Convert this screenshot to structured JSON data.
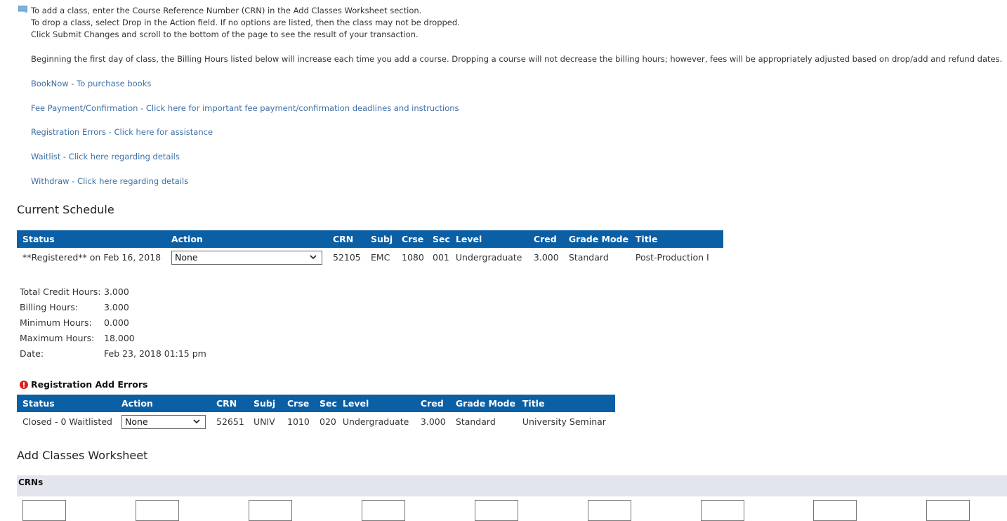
{
  "instructions": {
    "icon": "speech-bubble-icon",
    "lines": [
      "To add a class, enter the Course Reference Number (CRN) in the Add Classes Worksheet section.",
      "To drop a class, select Drop in the Action field. If no options are listed, then the class may not be dropped.",
      "Click Submit Changes and scroll to the bottom of the page to see the result of your transaction."
    ],
    "billing_note": "Beginning the first day of class, the Billing Hours listed below will increase each time you add a course. Dropping a course will not decrease the billing hours; however, fees will be appropriately adjusted based on drop/add and refund dates."
  },
  "links": [
    "BookNow - To purchase books",
    "Fee Payment/Confirmation - Click here for important fee payment/confirmation deadlines and instructions",
    "Registration Errors - Click here for assistance",
    "Waitlist - Click here regarding details",
    "Withdraw - Click here regarding details"
  ],
  "current_schedule": {
    "title": "Current Schedule",
    "columns": [
      "Status",
      "Action",
      "CRN",
      "Subj",
      "Crse",
      "Sec",
      "Level",
      "Cred",
      "Grade Mode",
      "Title"
    ],
    "rows": [
      {
        "status": "**Registered** on Feb 16, 2018",
        "action": "None",
        "crn": "52105",
        "subj": "EMC",
        "crse": "1080",
        "sec": "001",
        "level": "Undergraduate",
        "cred": "3.000",
        "grade_mode": "Standard",
        "title": "Post-Production I"
      }
    ]
  },
  "summary": [
    {
      "label": "Total Credit Hours:",
      "value": "3.000"
    },
    {
      "label": "Billing Hours:",
      "value": "3.000"
    },
    {
      "label": "Minimum Hours:",
      "value": "0.000"
    },
    {
      "label": "Maximum Hours:",
      "value": "18.000"
    },
    {
      "label": "Date:",
      "value": "Feb 23, 2018 01:15 pm"
    }
  ],
  "add_errors": {
    "title": "Registration Add Errors",
    "icon": "error-icon",
    "columns": [
      "Status",
      "Action",
      "CRN",
      "Subj",
      "Crse",
      "Sec",
      "Level",
      "Cred",
      "Grade Mode",
      "Title"
    ],
    "rows": [
      {
        "status": "Closed - 0 Waitlisted",
        "action": "None",
        "crn": "52651",
        "subj": "UNIV",
        "crse": "1010",
        "sec": "020",
        "level": "Undergraduate",
        "cred": "3.000",
        "grade_mode": "Standard",
        "title": "University Seminar"
      }
    ]
  },
  "worksheet": {
    "title": "Add Classes Worksheet",
    "crns_label": "CRNs",
    "crn_inputs": [
      "",
      "",
      "",
      "",
      "",
      "",
      "",
      "",
      ""
    ]
  },
  "colors": {
    "table_header": "#0b5fa5",
    "link": "#3d6fa5",
    "crn_bar": "#e2e4ee",
    "error": "#d9201a"
  }
}
